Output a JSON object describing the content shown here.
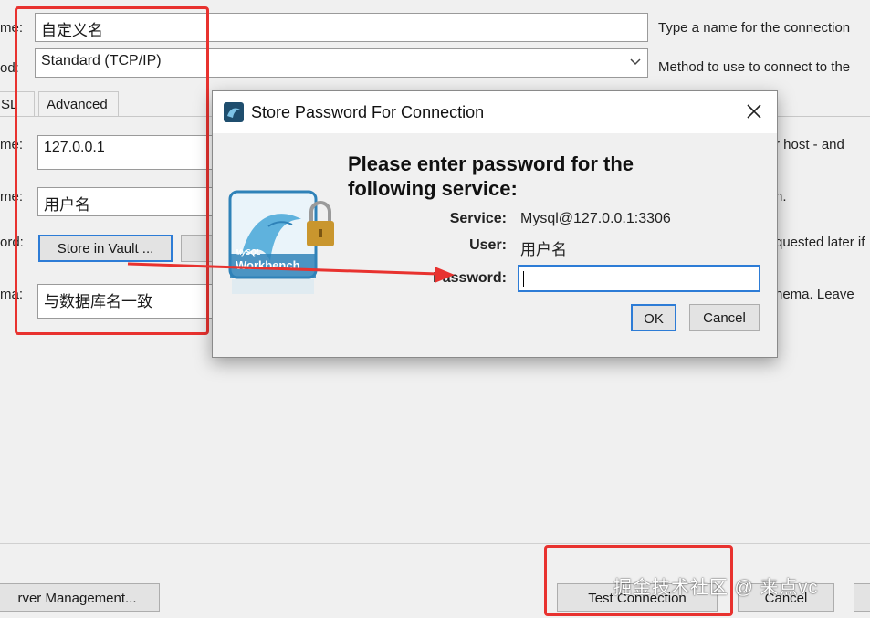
{
  "form": {
    "name_label_fragment": "me:",
    "name_value": "自定义名",
    "name_help": "Type a name for the connection",
    "method_label_fragment": "od:",
    "method_value": "Standard (TCP/IP)",
    "method_help": "Method to use to connect to the",
    "tab_ssl_fragment": "SL",
    "tab_advanced": "Advanced",
    "hostname_label_fragment": "me:",
    "hostname_value": "127.0.0.1",
    "hostname_help_fragment": "r host - and",
    "username_label_fragment": "me:",
    "username_value": "用户名",
    "username_help_fragment": "h.",
    "password_label_fragment": "ord:",
    "store_vault_label": "Store in Vault ...",
    "password_help_fragment": "quested later if",
    "schema_label_fragment": "ma:",
    "schema_value": "与数据库名一致",
    "schema_help_fragment": "hema. Leave"
  },
  "footer": {
    "server_mgmt_label": "rver Management...",
    "test_connection_label": "Test Connection",
    "cancel_label": "Cancel"
  },
  "dialog": {
    "title": "Store Password For Connection",
    "heading_line1": "Please enter password for the",
    "heading_line2": "following service:",
    "service_label": "Service:",
    "service_value": "Mysql@127.0.0.1:3306",
    "user_label": "User:",
    "user_value": "用户名",
    "password_label": "Password:",
    "password_value": "",
    "ok_label": "OK",
    "cancel_label": "Cancel",
    "logo_text_top": "MySQL",
    "logo_text_main": "Workbench"
  },
  "watermark": "掘金技术社区 @ 来点vc",
  "colors": {
    "annotation_red": "#e8322f",
    "focus_blue": "#2d7cd6",
    "window_bg": "#f0f0f0"
  }
}
